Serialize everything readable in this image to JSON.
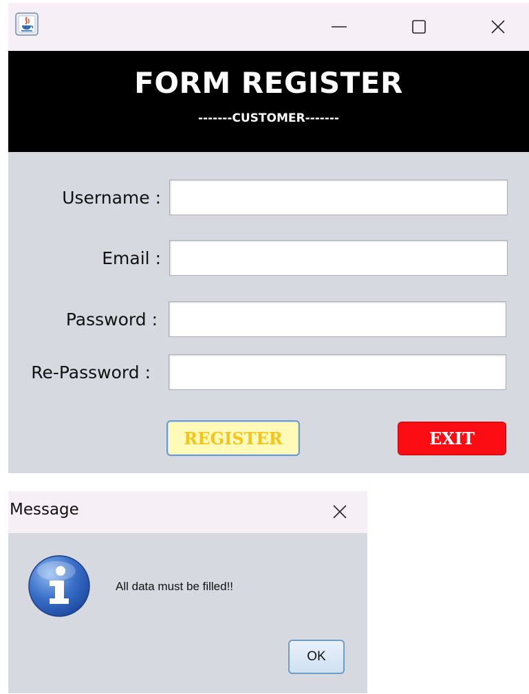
{
  "window": {
    "header_title": "FORM REGISTER",
    "header_subtitle": "-------CUSTOMER-------",
    "controls": {
      "minimize_icon": "minimize-icon",
      "maximize_icon": "maximize-icon",
      "close_icon": "close-icon"
    }
  },
  "form": {
    "username_label": "Username :",
    "username_value": "",
    "email_label": "Email :",
    "email_value": "",
    "password_label": "Password :",
    "password_value": "",
    "repassword_label": "Re-Password :",
    "repassword_value": "",
    "register_label": "REGISTER",
    "exit_label": "EXIT"
  },
  "dialog": {
    "title": "Message",
    "message": "All data must be filled!!",
    "ok_label": "OK",
    "icon": "info-icon"
  },
  "colors": {
    "header_bg": "#000000",
    "form_bg": "#d6d9e0",
    "titlebar_bg": "#f6eff5",
    "register_bg": "#fffab8",
    "register_text": "#f6c31a",
    "exit_bg": "#fb0d13",
    "exit_text": "#ffffff"
  }
}
